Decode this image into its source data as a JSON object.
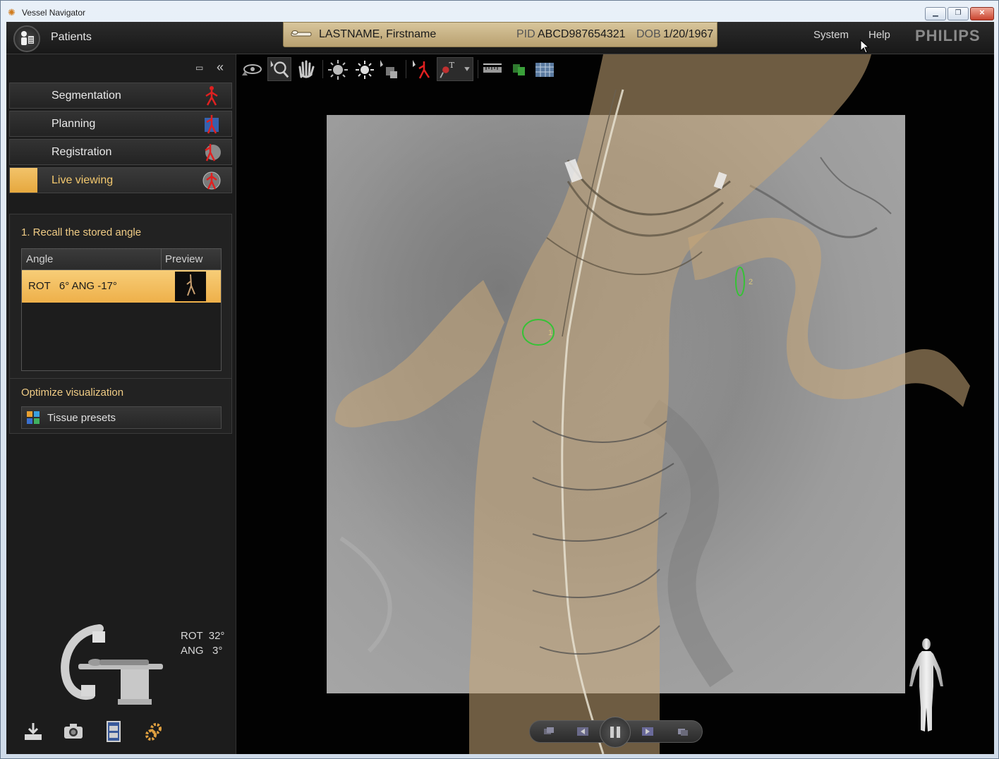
{
  "window": {
    "title": "Vessel Navigator"
  },
  "topbar": {
    "patients_label": "Patients",
    "patient": {
      "name": "LASTNAME, Firstname",
      "pid_label": "PID",
      "pid": "ABCD987654321",
      "dob_label": "DOB",
      "dob": "1/20/1967"
    },
    "menu": {
      "system": "System",
      "help": "Help"
    },
    "brand": "PHILIPS"
  },
  "workflow_steps": [
    {
      "label": "Segmentation",
      "icon": "segmentation-icon",
      "active": false
    },
    {
      "label": "Planning",
      "icon": "planning-icon",
      "active": false
    },
    {
      "label": "Registration",
      "icon": "registration-icon",
      "active": false
    },
    {
      "label": "Live viewing",
      "icon": "live-viewing-icon",
      "active": true
    }
  ],
  "task": {
    "title": "1. Recall the stored angle",
    "table": {
      "headers": [
        "Angle",
        "Preview"
      ],
      "rows": [
        {
          "angle": "ROT   6° ANG -17°",
          "selected": true
        }
      ]
    },
    "optimize_title": "Optimize visualization",
    "tissue_presets_label": "Tissue presets"
  },
  "geometry_readout": {
    "rot": "ROT  32°",
    "ang": "ANG   3°"
  },
  "markers": [
    {
      "label": "1"
    },
    {
      "label": "2"
    }
  ],
  "colors": {
    "accent": "#f2c36a",
    "overlay_vessel": "#c9a878",
    "marker": "#36c236"
  }
}
